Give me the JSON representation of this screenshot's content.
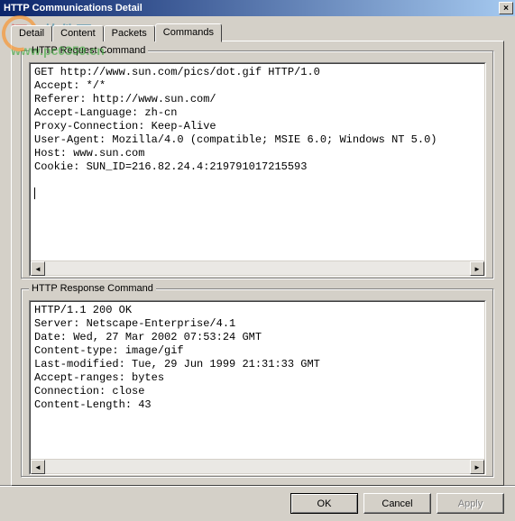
{
  "window": {
    "title": "HTTP Communications Detail",
    "close": "×"
  },
  "tabs": {
    "items": [
      {
        "label": "Detail"
      },
      {
        "label": "Content"
      },
      {
        "label": "Packets"
      },
      {
        "label": "Commands"
      }
    ],
    "active_index": 3
  },
  "request": {
    "legend": "HTTP Request Command",
    "text": "GET http://www.sun.com/pics/dot.gif HTTP/1.0\nAccept: */*\nReferer: http://www.sun.com/\nAccept-Language: zh-cn\nProxy-Connection: Keep-Alive\nUser-Agent: Mozilla/4.0 (compatible; MSIE 6.0; Windows NT 5.0)\nHost: www.sun.com\nCookie: SUN_ID=216.82.24.4:219791017215593\n\n"
  },
  "response": {
    "legend": "HTTP Response Command",
    "text": "HTTP/1.1 200 OK\nServer: Netscape-Enterprise/4.1\nDate: Wed, 27 Mar 2002 07:53:24 GMT\nContent-type: image/gif\nLast-modified: Tue, 29 Jun 1999 21:31:33 GMT\nAccept-ranges: bytes\nConnection: close\nContent-Length: 43"
  },
  "buttons": {
    "ok": "OK",
    "cancel": "Cancel",
    "apply": "Apply"
  },
  "scroll": {
    "left": "◄",
    "right": "►"
  },
  "watermark": {
    "line1": "河东软件园",
    "line2": "www.pc0359.cn"
  }
}
